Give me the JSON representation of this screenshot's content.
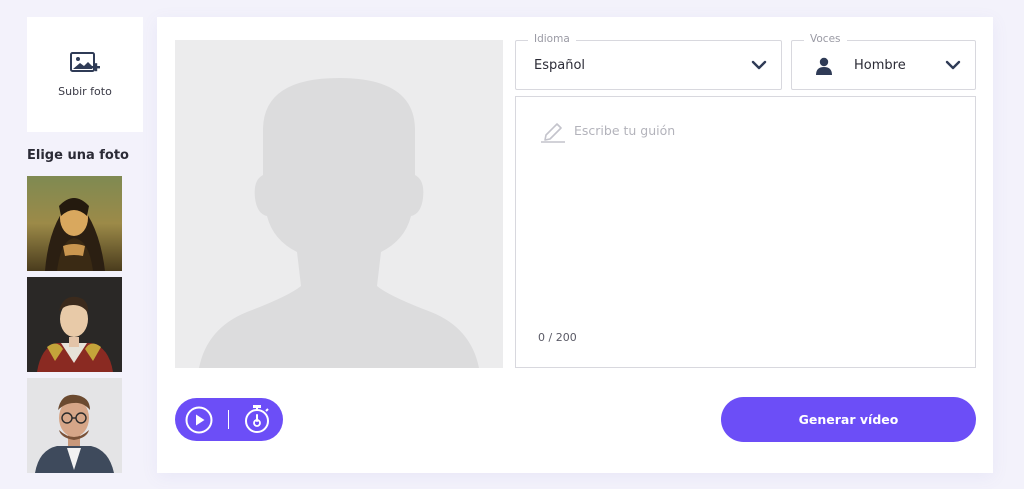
{
  "sidebar": {
    "upload_label": "Subir foto",
    "choose_title": "Elige una foto",
    "photos": [
      {
        "icon": "mona-lisa-portrait"
      },
      {
        "icon": "napoleon-portrait"
      },
      {
        "icon": "man-with-glasses-photo"
      }
    ]
  },
  "language": {
    "legend": "Idioma",
    "value": "Español"
  },
  "voice": {
    "legend": "Voces",
    "value": "Hombre"
  },
  "script": {
    "placeholder": "Escribe tu guión",
    "counter": "0 / 200"
  },
  "actions": {
    "generate_label": "Generar vídeo"
  },
  "colors": {
    "accent": "#6c4ef7",
    "background": "#f3f2fb",
    "placeholder_silhouette": "#dcdcdd"
  }
}
